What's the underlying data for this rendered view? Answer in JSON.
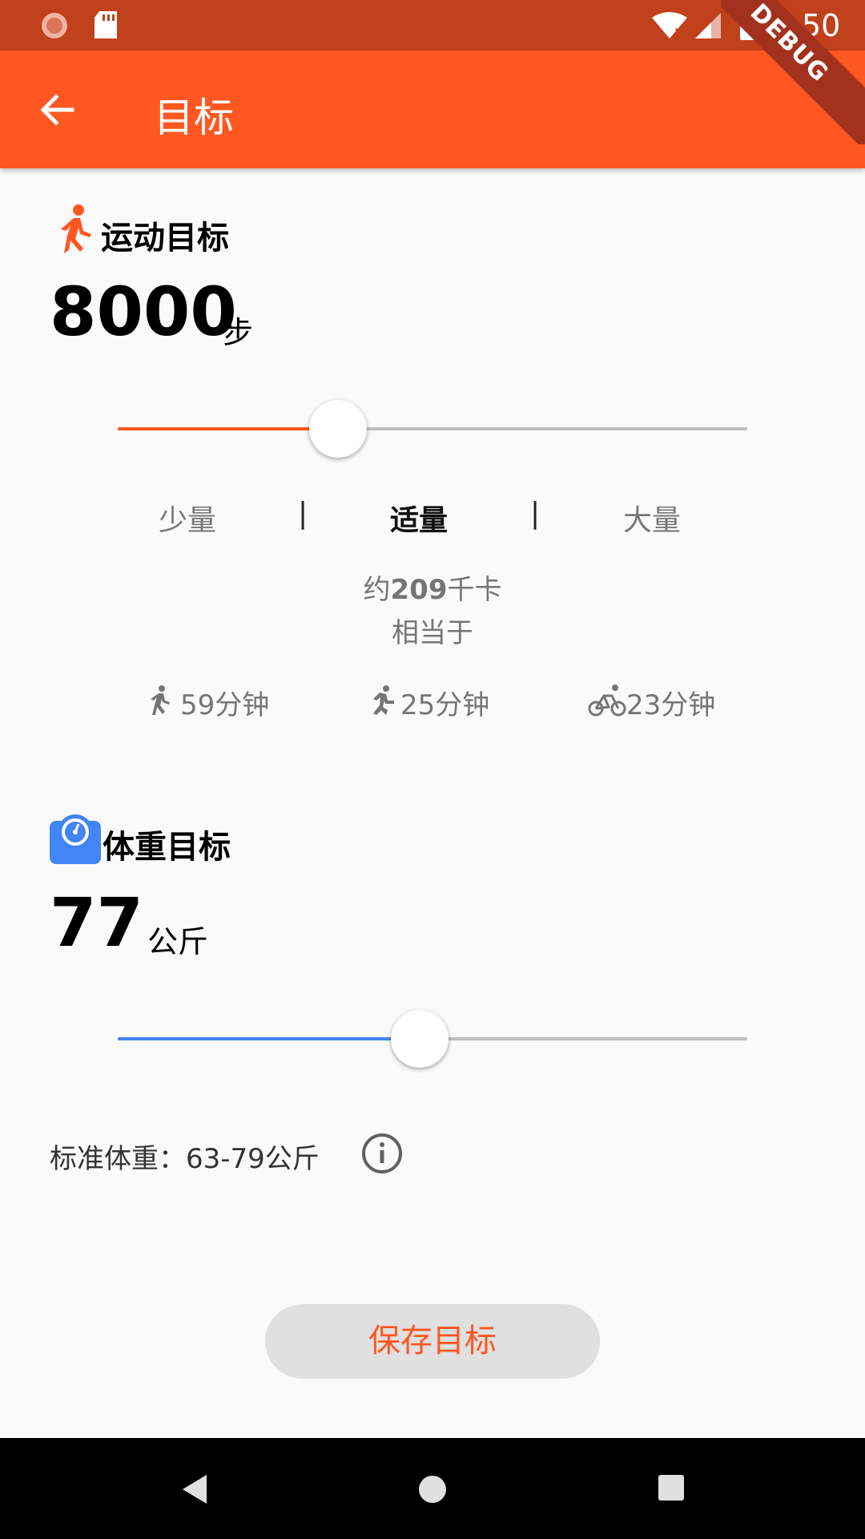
{
  "status_bar": {
    "time": "3:50",
    "debug_badge": "DEBUG"
  },
  "app_bar": {
    "title": "目标",
    "back_icon": "arrow-back-icon"
  },
  "exercise": {
    "section_title": "运动目标",
    "icon": "walking-person-icon",
    "steps_value": "8000",
    "steps_unit": "步",
    "slider_fraction": 0.35,
    "levels": [
      "少量",
      "适量",
      "大量"
    ],
    "level_separator": "|",
    "selected_level": "适量",
    "calories_prefix": "约",
    "calories_value": "209",
    "calories_suffix": "千卡",
    "equivalent_label": "相当于",
    "activities": [
      {
        "icon": "walk-icon",
        "label": "59分钟"
      },
      {
        "icon": "run-icon",
        "label": "25分钟"
      },
      {
        "icon": "bike-icon",
        "label": "23分钟"
      }
    ],
    "accent_color": "#ff5722"
  },
  "weight": {
    "section_title": "体重目标",
    "icon": "scale-icon",
    "value": "77",
    "unit": "公斤",
    "slider_fraction": 0.48,
    "standard_text": "标准体重：63-79公斤",
    "info_icon": "info-icon",
    "accent_color": "#4285f4"
  },
  "save_button": {
    "label": "保存目标"
  },
  "nav": {
    "back": "nav-back-icon",
    "home": "nav-home-icon",
    "recents": "nav-recents-icon"
  }
}
